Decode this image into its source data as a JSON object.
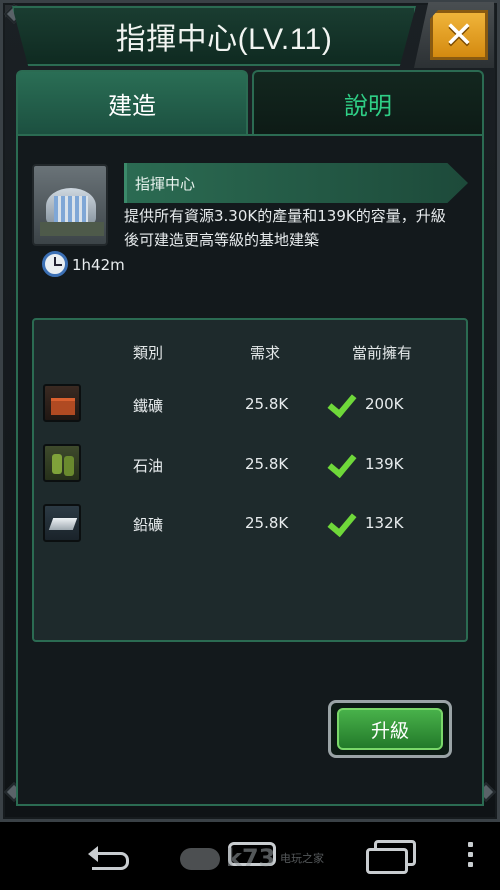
{
  "header": {
    "title": "指揮中心(LV.11)",
    "close_label": "✕"
  },
  "tabs": [
    {
      "label": "建造",
      "active": true
    },
    {
      "label": "說明",
      "active": false
    }
  ],
  "building": {
    "name": "指揮中心",
    "description": "提供所有資源3.30K的產量和139K的容量，升級後可建造更高等級的基地建築",
    "build_time": "1h42m",
    "thumbnail_icon": "command-center-building-icon"
  },
  "resources": {
    "headers": {
      "category": "類別",
      "required": "需求",
      "owned": "當前擁有"
    },
    "rows": [
      {
        "icon": "iron-ore-icon",
        "name": "鐵礦",
        "required": "25.8K",
        "owned": "200K",
        "sufficient": true
      },
      {
        "icon": "oil-barrel-icon",
        "name": "石油",
        "required": "25.8K",
        "owned": "139K",
        "sufficient": true
      },
      {
        "icon": "lead-ingot-icon",
        "name": "鉛礦",
        "required": "25.8K",
        "owned": "132K",
        "sufficient": true
      }
    ]
  },
  "actions": {
    "upgrade_label": "升級"
  },
  "watermark": {
    "brand": "k73",
    "text": "电玩之家"
  },
  "colors": {
    "accent_green": "#2b6b52",
    "tab_inactive_text": "#2fcf86",
    "check": "#6fd83a",
    "close_orange": "#e8a020"
  }
}
